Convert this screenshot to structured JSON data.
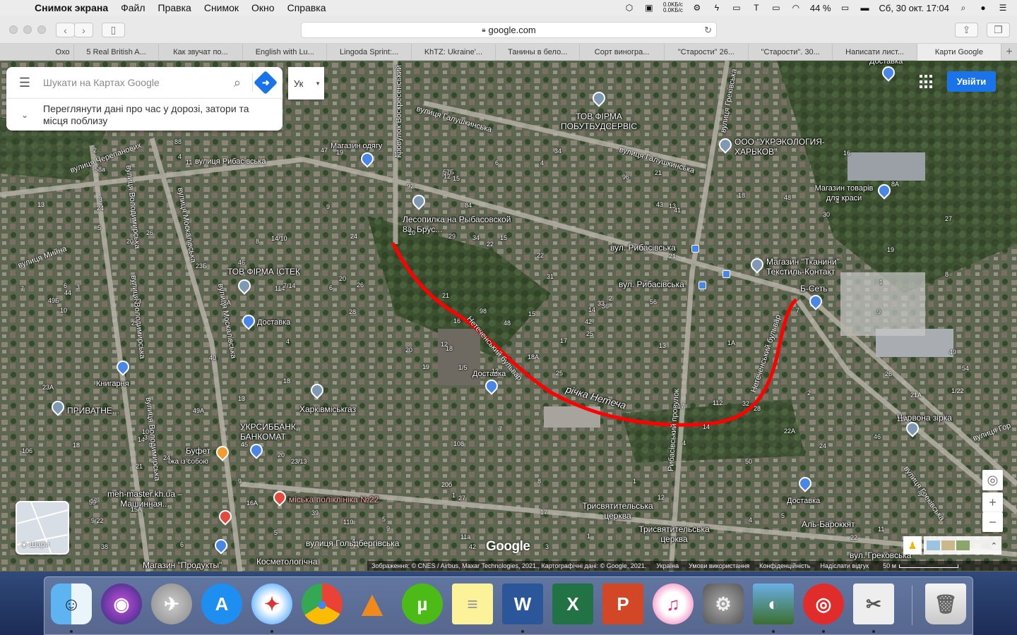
{
  "menubar": {
    "app": "Снимок экрана",
    "items": [
      "Файл",
      "Правка",
      "Снимок",
      "Окно",
      "Справка"
    ],
    "net_up": "0.0KБ/с",
    "net_down": "0.0KБ/с",
    "battery": "44 %",
    "datetime": "Сб, 30 окт.  17:04"
  },
  "browser": {
    "url": "google.com",
    "tabs": [
      "Охо",
      "5 Real British A...",
      "Как звучат по...",
      "English with Lu...",
      "Lingoda Sprint:...",
      "KhTZ: Ukraine'...",
      "Танины в бело...",
      "Сорт виногра...",
      "\"Старости\" 26...",
      "\"Старости\". 30...",
      "Написати лист...",
      "Карти Google"
    ],
    "active_tab": 11
  },
  "search": {
    "placeholder": "Шукати на Картах Google",
    "traffic_text": "Переглянути дані про час у дорозі, затори та місця поблизу",
    "lang": "Ук"
  },
  "header": {
    "signin": "Увійти"
  },
  "layers_label": "Шари",
  "map_labels": {
    "pois": [
      "ТОВ ФІРМА ПОБУТБУДСЕРВІС",
      "ООО \"УКРЭКОЛОГИЯ-ХАРЬКОВ\"",
      "Магазин товарів для краси",
      "Магазин одягу",
      "Лесопилка на Рыбасовской 8а, Брус...",
      "вул. Рибасівська",
      "вул. Рибасівська",
      "Магазин \"Тканини\" Текстиль-Контакт",
      "Б-Сеть",
      "ТОВ ФІРМА ІСТЕК",
      "Доставка",
      "Книгарня",
      "ПРИВАТНЕ...",
      "Харківміськгаз",
      "Доставка",
      "УКРСИББАНК, БАНКОМАТ",
      "Буфет",
      "Їжа із собою",
      "meh-master.kh.ua – Машинная...",
      "міська поліклініка №22",
      "Магазин \"Продукты\"",
      "Косметологічна",
      "Трисвятительська церква",
      "Трисвятительська церква",
      "Червона зірка",
      "Доставка",
      "Аль-Бароккят",
      "вул. Грековська",
      "Доставка"
    ],
    "streets": [
      "вулиця Галушкинська",
      "вулиця Галушкинська",
      "вулиця Черепанових",
      "вулиця Рибасівська",
      "провулок Воскресенський",
      "вулиця Володимирська",
      "вулиця Володимирська",
      "вулиця Володимирська",
      "вулиця Москалівська",
      "вулиця Москалівська",
      "вулиця Мийна",
      "вулиця Гольдбергівська",
      "Нетеченський бульвар",
      "Нетеченський бульвар",
      "Рибасівський провулок",
      "вулиця Греківська",
      "вулиця Греківська",
      "вулиця Гор"
    ],
    "river": "річка Нетеча",
    "numbers": [
      "12",
      "20",
      "18",
      "16",
      "14",
      "23/13",
      "21",
      "15",
      "13",
      "17",
      "11",
      "23",
      "25",
      "27",
      "19",
      "21",
      "6",
      "29",
      "31",
      "24",
      "26",
      "9/22",
      "16А",
      "34",
      "36",
      "28",
      "26",
      "15",
      "10",
      "17",
      "8",
      "12",
      "20б",
      "16",
      "14/10",
      "18",
      "20",
      "22",
      "30",
      "32",
      "34",
      "6",
      "8А",
      "4",
      "5",
      "7",
      "42",
      "38",
      "27",
      "25",
      "21",
      "19",
      "13",
      "14",
      "12",
      "9",
      "4",
      "2",
      "8",
      "4",
      "6",
      "4",
      "3",
      "46",
      "48",
      "88",
      "96",
      "92",
      "98",
      "106",
      "108",
      "110",
      "112",
      "114",
      "59",
      "58а",
      "23Б",
      "23А",
      "21",
      "17",
      "15",
      "15А",
      "13",
      "11А",
      "11а",
      "9",
      "7",
      "5",
      "3",
      "1",
      "57Б",
      "54",
      "56",
      "50",
      "48",
      "46",
      "44",
      "42",
      "43",
      "41",
      "40",
      "47",
      "49",
      "49Б",
      "49А",
      "45",
      "39",
      "33",
      "30",
      "28",
      "26",
      "24",
      "22",
      "20",
      "19",
      "18",
      "1/5",
      "8А",
      "10",
      "12",
      "14",
      "16",
      "22",
      "24",
      "1А",
      "13",
      "11",
      "9",
      "7",
      "5",
      "3",
      "1",
      "7/14",
      "9",
      "21А",
      "22А",
      "18",
      "10",
      "1/22",
      "20",
      "25",
      "23",
      "24",
      "18А",
      "2",
      "3",
      "5",
      "4",
      "1",
      "12",
      "1",
      "8",
      "6",
      "4",
      "2",
      "4",
      "84"
    ]
  },
  "attribution": {
    "imagery": "Зображення: © CNES / Airbus, Maxar Technologies, 2021., Картографічні дані: © Google, 2021.",
    "country": "Україна",
    "terms": "Умови використання",
    "privacy": "Конфіденційність",
    "feedback": "Надіслати відгук",
    "scale": "50 м"
  },
  "logo": "Google",
  "colors": {
    "route": "#ff0000",
    "signin": "#1a73e8",
    "pin": "#7f98b3",
    "pin_blue": "#4a86e8"
  },
  "dock": [
    "finder-icon",
    "siri-icon",
    "launchpad-icon",
    "app-store-icon",
    "safari-icon",
    "chrome-icon",
    "vlc-icon",
    "utorrent-icon",
    "notes-icon",
    "word-icon",
    "excel-icon",
    "powerpoint-icon",
    "itunes-icon",
    "system-preferences-icon",
    "preview-icon",
    "pdf-icon",
    "screenshot-icon",
    "trash-icon"
  ]
}
